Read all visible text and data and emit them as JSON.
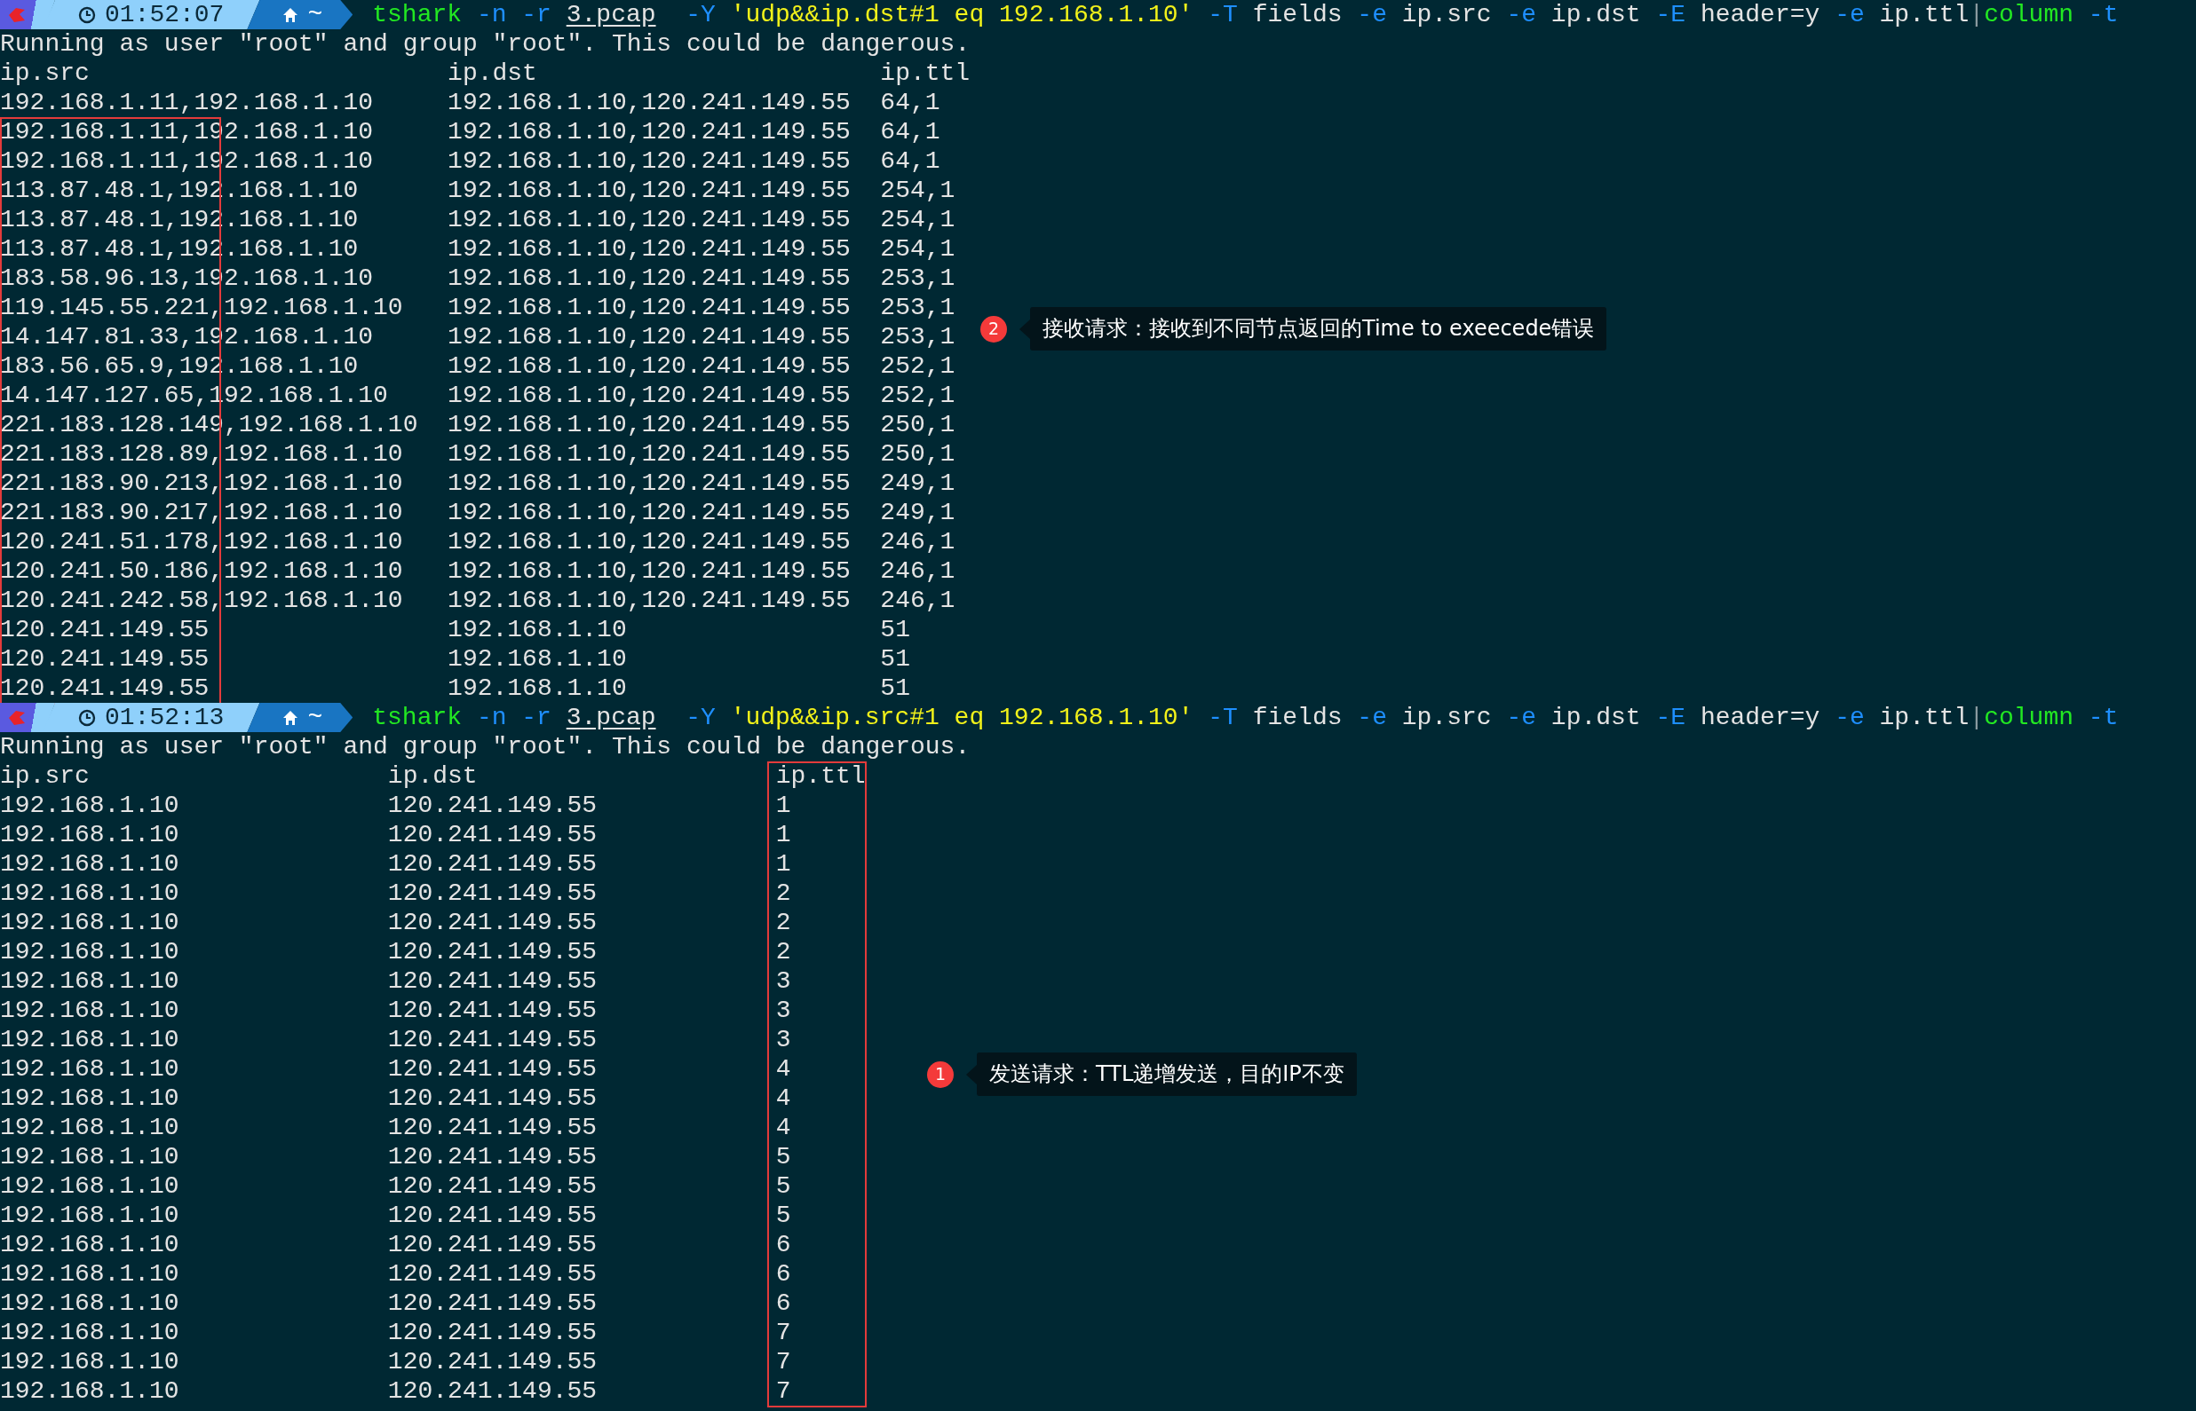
{
  "blocks": [
    {
      "prompt": {
        "time": "01:52:07",
        "dir": "~"
      },
      "command": [
        {
          "kind": "command",
          "text": "tshark"
        },
        {
          "kind": "flag",
          "text": "-n"
        },
        {
          "kind": "flag",
          "text": "-r"
        },
        {
          "kind": "path",
          "text": "3.pcap"
        },
        {
          "kind": "flag",
          "text": "-Y"
        },
        {
          "kind": "string",
          "text": "'udp&&ip.dst#1 eq 192.168.1.10'"
        },
        {
          "kind": "flag",
          "text": "-T"
        },
        {
          "kind": "arg",
          "text": "fields"
        },
        {
          "kind": "flag",
          "text": "-e"
        },
        {
          "kind": "arg",
          "text": "ip.src"
        },
        {
          "kind": "flag",
          "text": "-e"
        },
        {
          "kind": "arg",
          "text": "ip.dst"
        },
        {
          "kind": "flag",
          "text": "-E"
        },
        {
          "kind": "arg",
          "text": "header=y"
        },
        {
          "kind": "flag",
          "text": "-e"
        },
        {
          "kind": "arg",
          "text": "ip.ttl"
        },
        {
          "kind": "pipe",
          "text": "|"
        },
        {
          "kind": "command",
          "text": "column"
        },
        {
          "kind": "flag",
          "text": "-t"
        }
      ],
      "warning": "Running as user \"root\" and group \"root\". This could be dangerous.",
      "columns": [
        {
          "label": "ip.src",
          "highlighted": true
        },
        {
          "label": "ip.dst",
          "highlighted": false
        },
        {
          "label": "ip.ttl",
          "highlighted": false
        }
      ],
      "rows": [
        [
          "192.168.1.11,192.168.1.10",
          "192.168.1.10,120.241.149.55",
          "64,1"
        ],
        [
          "192.168.1.11,192.168.1.10",
          "192.168.1.10,120.241.149.55",
          "64,1"
        ],
        [
          "192.168.1.11,192.168.1.10",
          "192.168.1.10,120.241.149.55",
          "64,1"
        ],
        [
          "113.87.48.1,192.168.1.10",
          "192.168.1.10,120.241.149.55",
          "254,1"
        ],
        [
          "113.87.48.1,192.168.1.10",
          "192.168.1.10,120.241.149.55",
          "254,1"
        ],
        [
          "113.87.48.1,192.168.1.10",
          "192.168.1.10,120.241.149.55",
          "254,1"
        ],
        [
          "183.58.96.13,192.168.1.10",
          "192.168.1.10,120.241.149.55",
          "253,1"
        ],
        [
          "119.145.55.221,192.168.1.10",
          "192.168.1.10,120.241.149.55",
          "253,1"
        ],
        [
          "14.147.81.33,192.168.1.10",
          "192.168.1.10,120.241.149.55",
          "253,1"
        ],
        [
          "183.56.65.9,192.168.1.10",
          "192.168.1.10,120.241.149.55",
          "252,1"
        ],
        [
          "14.147.127.65,192.168.1.10",
          "192.168.1.10,120.241.149.55",
          "252,1"
        ],
        [
          "221.183.128.149,192.168.1.10",
          "192.168.1.10,120.241.149.55",
          "250,1"
        ],
        [
          "221.183.128.89,192.168.1.10",
          "192.168.1.10,120.241.149.55",
          "250,1"
        ],
        [
          "221.183.90.213,192.168.1.10",
          "192.168.1.10,120.241.149.55",
          "249,1"
        ],
        [
          "221.183.90.217,192.168.1.10",
          "192.168.1.10,120.241.149.55",
          "249,1"
        ],
        [
          "120.241.51.178,192.168.1.10",
          "192.168.1.10,120.241.149.55",
          "246,1"
        ],
        [
          "120.241.50.186,192.168.1.10",
          "192.168.1.10,120.241.149.55",
          "246,1"
        ],
        [
          "120.241.242.58,192.168.1.10",
          "192.168.1.10,120.241.149.55",
          "246,1"
        ],
        [
          "120.241.149.55",
          "192.168.1.10",
          "51"
        ],
        [
          "120.241.149.55",
          "192.168.1.10",
          "51"
        ],
        [
          "120.241.149.55",
          "192.168.1.10",
          "51"
        ]
      ],
      "highlight_includes_header": false,
      "callout": {
        "number": "2",
        "text": "接收请求：接收到不同节点返回的Time to exeecede错误"
      }
    },
    {
      "prompt": {
        "time": "01:52:13",
        "dir": "~"
      },
      "command": [
        {
          "kind": "command",
          "text": "tshark"
        },
        {
          "kind": "flag",
          "text": "-n"
        },
        {
          "kind": "flag",
          "text": "-r"
        },
        {
          "kind": "path",
          "text": "3.pcap"
        },
        {
          "kind": "flag",
          "text": "-Y"
        },
        {
          "kind": "string",
          "text": "'udp&&ip.src#1 eq 192.168.1.10'"
        },
        {
          "kind": "flag",
          "text": "-T"
        },
        {
          "kind": "arg",
          "text": "fields"
        },
        {
          "kind": "flag",
          "text": "-e"
        },
        {
          "kind": "arg",
          "text": "ip.src"
        },
        {
          "kind": "flag",
          "text": "-e"
        },
        {
          "kind": "arg",
          "text": "ip.dst"
        },
        {
          "kind": "flag",
          "text": "-E"
        },
        {
          "kind": "arg",
          "text": "header=y"
        },
        {
          "kind": "flag",
          "text": "-e"
        },
        {
          "kind": "arg",
          "text": "ip.ttl"
        },
        {
          "kind": "pipe",
          "text": "|"
        },
        {
          "kind": "command",
          "text": "column"
        },
        {
          "kind": "flag",
          "text": "-t"
        }
      ],
      "warning": "Running as user \"root\" and group \"root\". This could be dangerous.",
      "columns": [
        {
          "label": "ip.src",
          "highlighted": false
        },
        {
          "label": "ip.dst",
          "highlighted": false
        },
        {
          "label": "ip.ttl",
          "highlighted": true
        }
      ],
      "rows": [
        [
          "192.168.1.10",
          "120.241.149.55",
          "1"
        ],
        [
          "192.168.1.10",
          "120.241.149.55",
          "1"
        ],
        [
          "192.168.1.10",
          "120.241.149.55",
          "1"
        ],
        [
          "192.168.1.10",
          "120.241.149.55",
          "2"
        ],
        [
          "192.168.1.10",
          "120.241.149.55",
          "2"
        ],
        [
          "192.168.1.10",
          "120.241.149.55",
          "2"
        ],
        [
          "192.168.1.10",
          "120.241.149.55",
          "3"
        ],
        [
          "192.168.1.10",
          "120.241.149.55",
          "3"
        ],
        [
          "192.168.1.10",
          "120.241.149.55",
          "3"
        ],
        [
          "192.168.1.10",
          "120.241.149.55",
          "4"
        ],
        [
          "192.168.1.10",
          "120.241.149.55",
          "4"
        ],
        [
          "192.168.1.10",
          "120.241.149.55",
          "4"
        ],
        [
          "192.168.1.10",
          "120.241.149.55",
          "5"
        ],
        [
          "192.168.1.10",
          "120.241.149.55",
          "5"
        ],
        [
          "192.168.1.10",
          "120.241.149.55",
          "5"
        ],
        [
          "192.168.1.10",
          "120.241.149.55",
          "6"
        ],
        [
          "192.168.1.10",
          "120.241.149.55",
          "6"
        ],
        [
          "192.168.1.10",
          "120.241.149.55",
          "6"
        ],
        [
          "192.168.1.10",
          "120.241.149.55",
          "7"
        ],
        [
          "192.168.1.10",
          "120.241.149.55",
          "7"
        ],
        [
          "192.168.1.10",
          "120.241.149.55",
          "7"
        ]
      ],
      "highlight_includes_header": true,
      "callout": {
        "number": "1",
        "text": "发送请求：TTL递增发送，目的IP不变"
      }
    }
  ]
}
